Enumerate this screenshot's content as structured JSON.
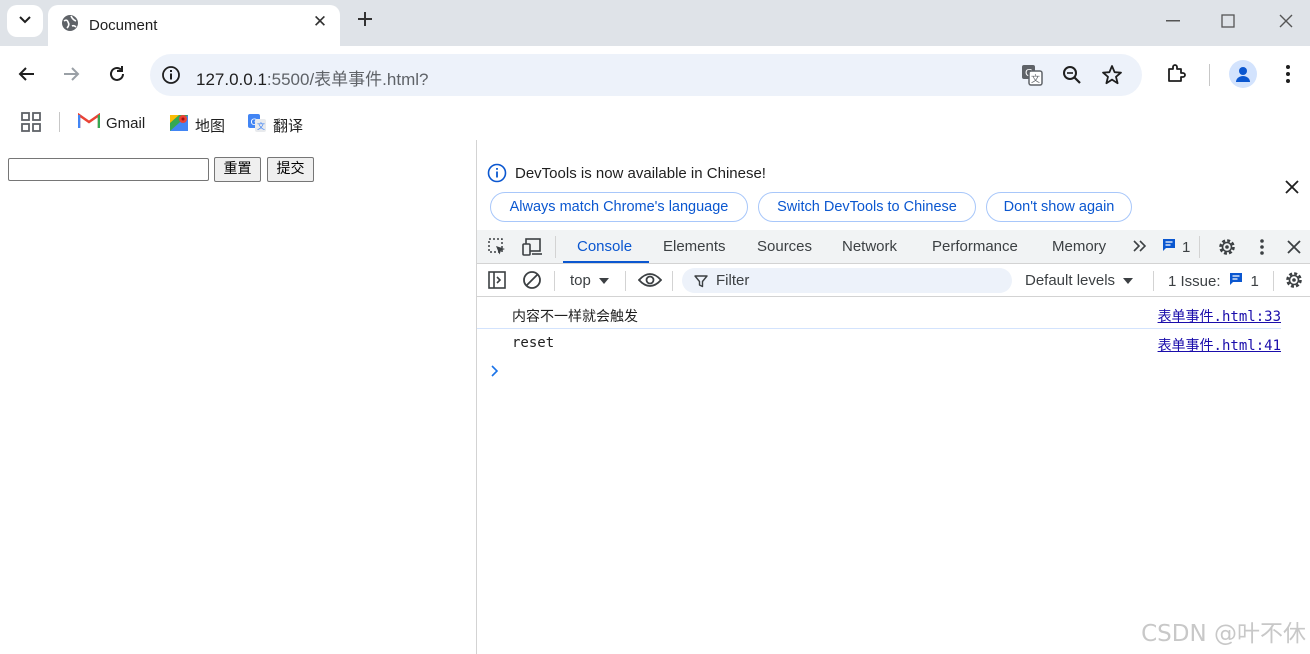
{
  "browser": {
    "tab": {
      "title": "Document"
    },
    "address": {
      "host": "127.0.0.1",
      "rest": ":5500/表单事件.html?"
    },
    "bookmarks": [
      {
        "label": "Gmail"
      },
      {
        "label": "地图"
      },
      {
        "label": "翻译"
      }
    ]
  },
  "page": {
    "input_value": "",
    "reset_label": "重置",
    "submit_label": "提交"
  },
  "devtools": {
    "infobar": {
      "message": "DevTools is now available in Chinese!",
      "btn_match": "Always match Chrome's language",
      "btn_switch": "Switch DevTools to Chinese",
      "btn_dont": "Don't show again"
    },
    "tabs": [
      "Console",
      "Elements",
      "Sources",
      "Network",
      "Performance",
      "Memory"
    ],
    "issues_badge": "1",
    "console_bar": {
      "context": "top",
      "filter_placeholder": "Filter",
      "levels": "Default levels",
      "issues_label": "1 Issue:",
      "issues_count": "1"
    },
    "logs": [
      {
        "message": "内容不一样就会触发",
        "source": "表单事件.html:33"
      },
      {
        "message": "reset",
        "source": "表单事件.html:41"
      }
    ]
  },
  "watermark": "CSDN @叶不休",
  "colors": {
    "accent": "#0b57d0",
    "tabbar": "#dfe3e8",
    "omnibox": "#edf2fa"
  }
}
